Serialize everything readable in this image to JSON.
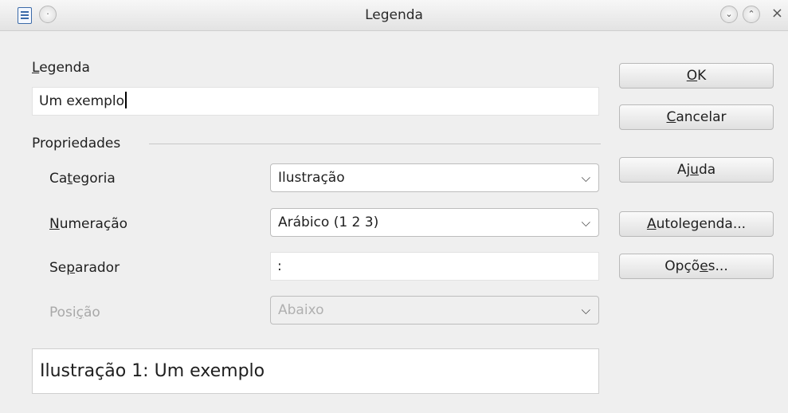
{
  "window": {
    "title": "Legenda",
    "icons": [
      "document-icon",
      "menu-circle-icon",
      "minimize-icon",
      "maximize-icon",
      "close-icon"
    ],
    "close_glyph": "×"
  },
  "caption": {
    "label_prefix": "L",
    "label_rest": "egenda",
    "value": "Um exemplo"
  },
  "properties": {
    "group_label": "Propriedades",
    "category": {
      "p1": "Ca",
      "key": "t",
      "p2": "egoria",
      "value": "Ilustração"
    },
    "numbering": {
      "p1": "",
      "key": "N",
      "p2": "umeração",
      "value": "Arábico (1 2 3)"
    },
    "separator": {
      "p1": "Se",
      "key": "p",
      "p2": "arador",
      "value": ":"
    },
    "position": {
      "p1": "Posi",
      "key": "ç",
      "p2": "ão",
      "value": "Abaixo",
      "disabled": true
    }
  },
  "preview": {
    "text": "Ilustração 1: Um exemplo"
  },
  "buttons": {
    "ok": {
      "p1": "",
      "key": "O",
      "p2": "K"
    },
    "cancel": {
      "p1": "",
      "key": "C",
      "p2": "ancelar"
    },
    "help": {
      "p1": "Aj",
      "key": "u",
      "p2": "da"
    },
    "autocaption": {
      "p1": "",
      "key": "A",
      "p2": "utolegenda..."
    },
    "options": {
      "p1": "Opçõ",
      "key": "e",
      "p2": "s..."
    }
  },
  "colors": {
    "background": "#efefef",
    "field": "#ffffff",
    "disabled_text": "#a8a8a8"
  }
}
